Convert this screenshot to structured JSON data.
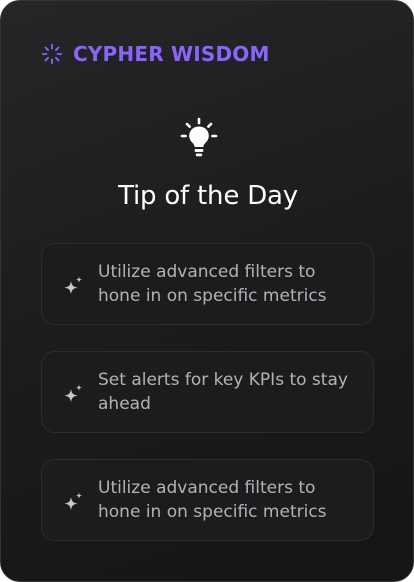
{
  "brand": {
    "title": "CYPHER WISDOM",
    "icon": "loader-icon",
    "accent_color": "#8b63ff"
  },
  "header": {
    "icon": "lightbulb-icon",
    "title": "Tip of the Day"
  },
  "tips": [
    {
      "icon": "sparkle-icon",
      "text": "Utilize advanced filters to hone in on specific metrics"
    },
    {
      "icon": "sparkle-icon",
      "text": "Set alerts for key KPIs to stay ahead"
    },
    {
      "icon": "sparkle-icon",
      "text": "Utilize advanced filters to hone in on specific metrics"
    }
  ]
}
